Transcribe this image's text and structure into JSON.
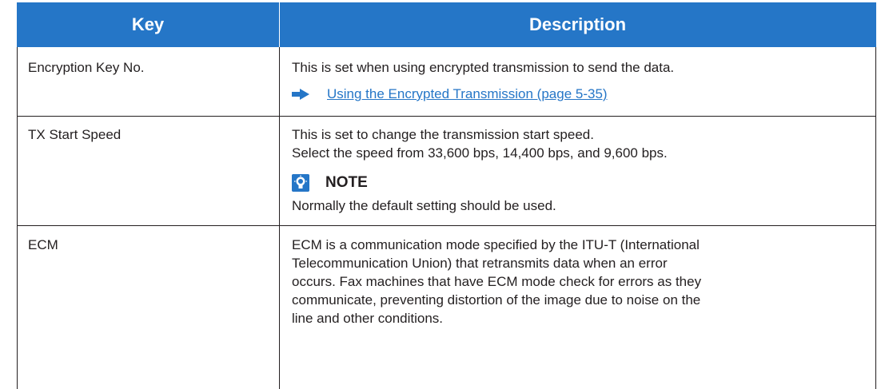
{
  "header": {
    "key": "Key",
    "description": "Description"
  },
  "rows": [
    {
      "key": "Encryption Key No.",
      "description": "This is set when using encrypted transmission to send the data.",
      "link": "Using the Encrypted Transmission (page 5-35)",
      "link_icon": "arrow-right-icon"
    },
    {
      "key": "TX Start Speed",
      "description_lines": [
        "This is set to change the transmission start speed.",
        "Select the speed from 33,600 bps, 14,400 bps, and 9,600 bps."
      ],
      "note_label": "NOTE",
      "note_icon": "lightbulb-icon",
      "note_text": "Normally the default setting should be used."
    },
    {
      "key": "ECM",
      "description_lines": [
        "ECM is a communication mode specified by the ITU-T (International",
        "Telecommunication Union) that retransmits data when an error",
        "occurs. Fax machines that have ECM mode check for errors as they",
        "communicate, preventing distortion of the image due to noise on the",
        "line and other conditions."
      ]
    }
  ],
  "colors": {
    "header_bg": "#2576c7",
    "link": "#2576c7",
    "text": "#231f20",
    "rule": "#231f20"
  }
}
